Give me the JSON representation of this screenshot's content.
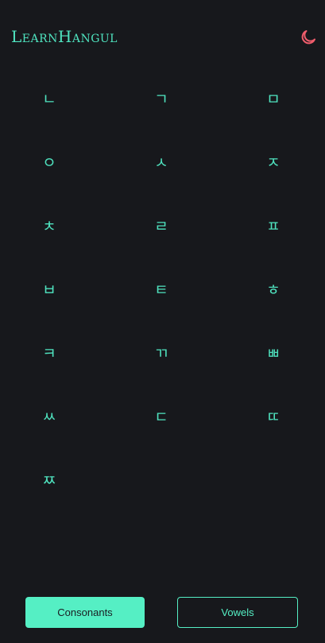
{
  "header": {
    "title": "LearnHangul",
    "theme_icon": "moon-icon",
    "theme_icon_color": "#f05d6c"
  },
  "consonants": [
    "ㄴ",
    "ㄱ",
    "ㅁ",
    "ㅇ",
    "ㅅ",
    "ㅈ",
    "ㅊ",
    "ㄹ",
    "ㅍ",
    "ㅂ",
    "ㅌ",
    "ㅎ",
    "ㅋ",
    "ㄲ",
    "ㅃ",
    "ㅆ",
    "ㄷ",
    "ㄸ",
    "ㅉ"
  ],
  "footer": {
    "consonants_label": "Consonants",
    "vowels_label": "Vowels",
    "active_tab": "Consonants"
  },
  "colors": {
    "background": "#17181c",
    "accent": "#55efc4",
    "glyph": "#4fe3bf"
  }
}
